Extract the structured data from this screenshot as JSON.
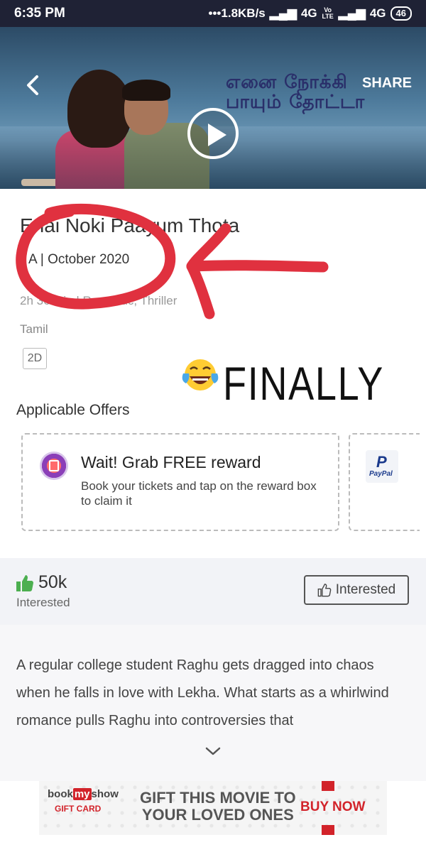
{
  "status_bar": {
    "time": "6:35 PM",
    "network": "•••1.8KB/s",
    "signal1": "4G",
    "volte": "Vo LTE",
    "signal2": "4G",
    "battery": "46"
  },
  "header": {
    "share_label": "SHARE",
    "poster_title_line1": "எனை நோக்கி",
    "poster_title_line2": "பாயும் தோட்டா"
  },
  "movie": {
    "title": "Enai Noki Paayum Thota",
    "meta": "A | October 2020",
    "duration_genres": "2h 36 min | Romantic, Thriller",
    "language": "Tamil",
    "format": "2D"
  },
  "annotation": {
    "text": "FINALLY",
    "emoji": "tears-of-joy-emoji"
  },
  "offers": {
    "title": "Applicable Offers",
    "items": [
      {
        "title": "Wait! Grab FREE reward",
        "description": "Book your tickets and tap on the reward box to claim it",
        "icon": "gift-reward-icon"
      },
      {
        "title": "",
        "logo_text": "P",
        "logo_subtext": "PayPal",
        "icon": "paypal-logo"
      }
    ]
  },
  "interest": {
    "count": "50k",
    "label": "Interested",
    "button_label": "Interested"
  },
  "synopsis": {
    "text": "A regular college student Raghu gets dragged into chaos when he falls in love with Lekha. What starts as a whirlwind romance pulls Raghu into controversies that"
  },
  "banner": {
    "logo_book": "book",
    "logo_my": "my",
    "logo_show": "show",
    "giftcard_label": "GIFT CARD",
    "line1": "GIFT THIS MOVIE TO",
    "line2": "YOUR LOVED ONES",
    "buy_now": "BUY NOW"
  },
  "colors": {
    "status_bar": "#1f2235",
    "annotation_red": "#e0313f",
    "thumb_green": "#4caf50",
    "brand_red": "#d2232a"
  }
}
